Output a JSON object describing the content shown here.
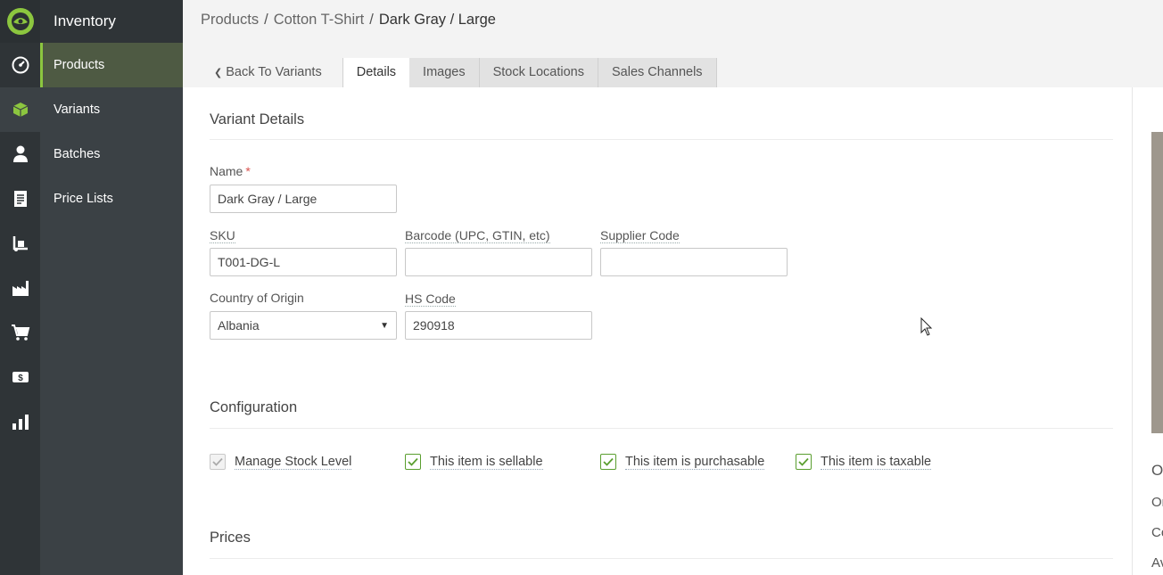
{
  "app": {
    "title": "Inventory"
  },
  "nav": {
    "items": [
      {
        "label": "Products",
        "active": true
      },
      {
        "label": "Variants"
      },
      {
        "label": "Batches"
      },
      {
        "label": "Price Lists"
      }
    ]
  },
  "rail": {
    "icons": [
      "dashboard-icon",
      "box-icon",
      "user-icon",
      "document-icon",
      "hand-truck-icon",
      "factory-icon",
      "cart-icon",
      "dollar-icon",
      "bar-chart-icon"
    ],
    "active_color": "#8cc63f"
  },
  "breadcrumb": {
    "items": [
      "Products",
      "Cotton T-Shirt"
    ],
    "current": "Dark Gray / Large",
    "separator": "/"
  },
  "tabs": {
    "back": "Back To Variants",
    "items": [
      "Details",
      "Images",
      "Stock Locations",
      "Sales Channels"
    ],
    "active": "Details"
  },
  "variant_details": {
    "title": "Variant Details",
    "name": {
      "label": "Name",
      "required": "*",
      "value": "Dark Gray / Large"
    },
    "sku": {
      "label": "SKU",
      "value": "T001-DG-L"
    },
    "barcode": {
      "label": "Barcode (UPC, GTIN, etc)",
      "value": ""
    },
    "supplier_code": {
      "label": "Supplier Code",
      "value": ""
    },
    "country": {
      "label": "Country of Origin",
      "value": "Albania"
    },
    "hs_code": {
      "label": "HS Code",
      "value": "290918"
    }
  },
  "configuration": {
    "title": "Configuration",
    "options": [
      {
        "label": "Manage Stock Level",
        "checked": true,
        "disabled": true
      },
      {
        "label": "This item is sellable",
        "checked": true
      },
      {
        "label": "This item is purchasable",
        "checked": true
      },
      {
        "label": "This item is taxable",
        "checked": true
      }
    ]
  },
  "prices": {
    "title": "Prices"
  },
  "right_pane": {
    "heading": "Ov",
    "lines": [
      "Or",
      "Co",
      "Av"
    ]
  },
  "colors": {
    "accent": "#8cc63f",
    "sidebar": "#3b4145",
    "rail": "#2f3437"
  }
}
